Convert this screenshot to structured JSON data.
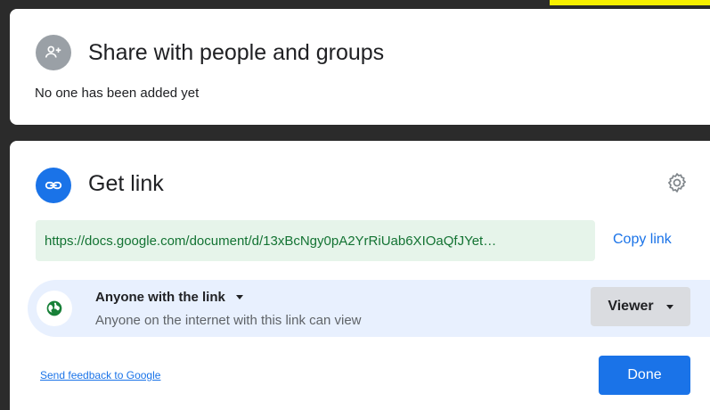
{
  "share_people": {
    "title": "Share with people and groups",
    "status": "No one has been added yet",
    "icon": "add-person-icon",
    "icon_bg": "#9aa0a6"
  },
  "get_link": {
    "title": "Get link",
    "icon": "link-icon",
    "icon_bg": "#1a73e8",
    "settings_icon": "gear-icon",
    "url": "https://docs.google.com/document/d/13xBcNgy0pA2YrRiUab6XIOaQfJYet…",
    "copy_label": "Copy link",
    "access": {
      "label": "Anyone with the link",
      "description": "Anyone on the internet with this link can view",
      "icon": "globe-icon",
      "role": "Viewer"
    },
    "feedback_label": "Send feedback to Google",
    "done_label": "Done"
  },
  "colors": {
    "accent": "#1a73e8",
    "url_bg": "#e6f4ea",
    "url_text": "#137333",
    "access_bg": "#e8f0fe",
    "globe": "#188038"
  }
}
